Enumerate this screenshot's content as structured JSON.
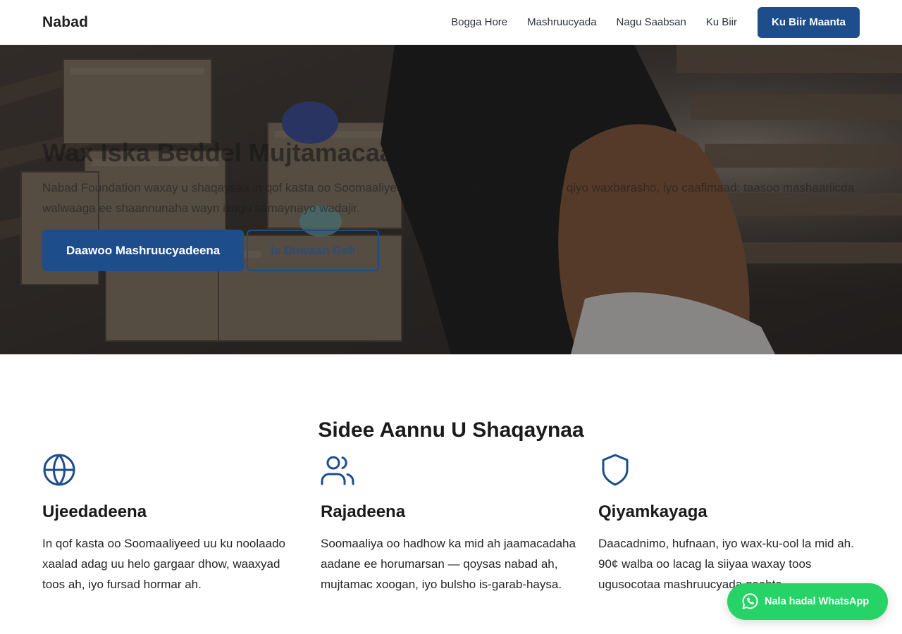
{
  "navbar": {
    "brand": "Nabad",
    "links": [
      "Bogga Hore",
      "Mashruucyada",
      "Nagu Saabsan",
      "Ku Biir"
    ],
    "cta": "Ku Biir Maanta"
  },
  "hero": {
    "title": "Wax Iska Beddel Mujtamacaaga",
    "text": "Nabad Foundation waxay u shaqaysaa in qof kasta oo Soomaaliyeed uu helo baahi aasaasiga ah, qiyo waxbarasho, iyo caafimaad; taasoo mashaariicda walwaaga ee shaannunaha wayn isugu samaynayo wadajir.",
    "primary_button": "Daawoo Mashruucyadeena",
    "secondary_button": "Is Diiwaan Geli"
  },
  "section": {
    "title": "Sidee Aannu U Shaqaynaa",
    "features": [
      {
        "icon": "globe-icon",
        "title": "Ujeedadeena",
        "text": "In qof kasta oo Soomaaliyeed uu ku noolaado xaalad adag uu helo gargaar dhow, waaxyad toos ah, iyo fursad hormar ah."
      },
      {
        "icon": "users-icon",
        "title": "Rajadeena",
        "text": "Soomaaliya oo hadhow ka mid ah jaamacadaha aadane ee horumarsan — qoysas nabad ah, mujtamac xoogan, iyo bulsho is-garab-haysa."
      },
      {
        "icon": "shield-icon",
        "title": "Qiyamkayaga",
        "text": "Daacadnimo, hufnaan, iyo wax-ku-ool la mid ah. 90¢ walba oo lacag la siiyaa waxay toos ugusocotaa mashruucyada goobta."
      }
    ]
  },
  "whatsapp": {
    "label": "Nala hadal WhatsApp",
    "icon": "whatsapp-icon"
  },
  "colors": {
    "primary": "#1e4d8c",
    "whatsapp": "#25d366"
  }
}
